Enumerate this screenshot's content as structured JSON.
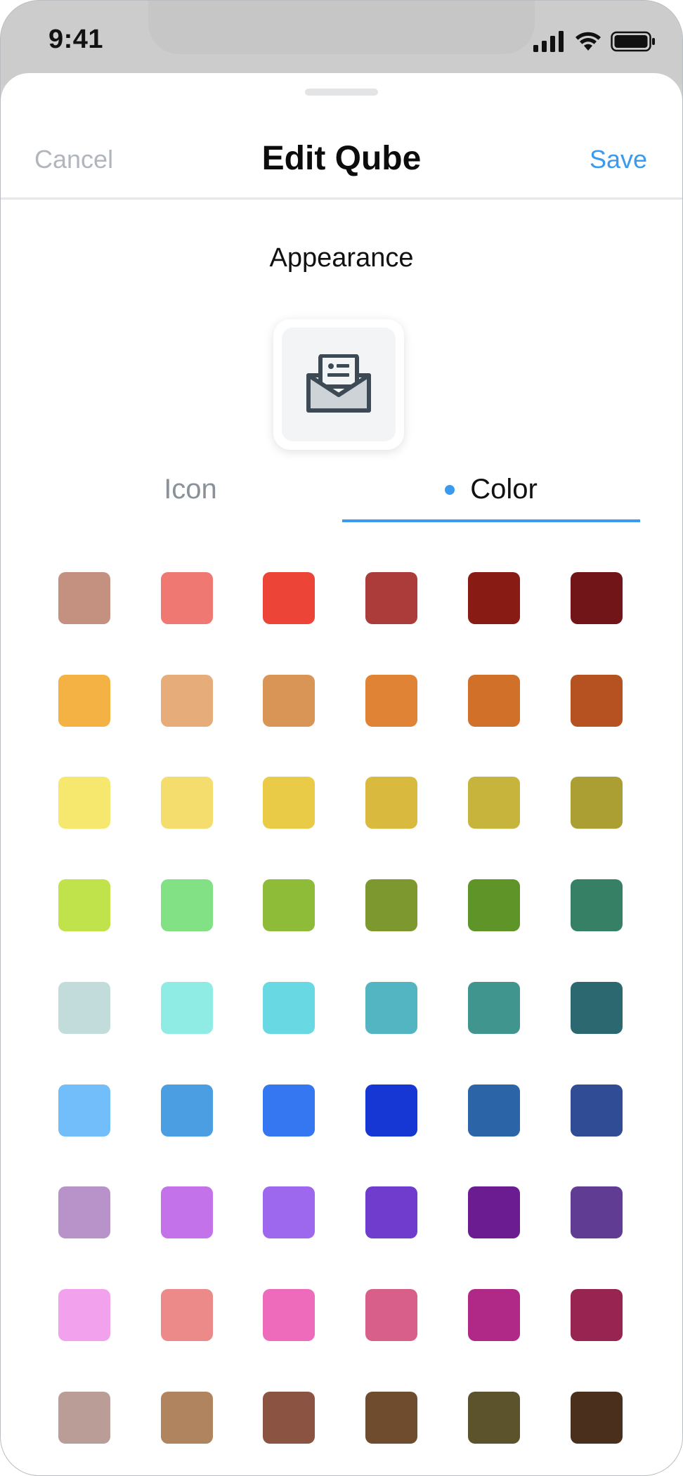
{
  "status_bar": {
    "time": "9:41",
    "icons": [
      "signal-icon",
      "wifi-icon",
      "battery-icon"
    ]
  },
  "nav": {
    "cancel_label": "Cancel",
    "title": "Edit Qube",
    "save_label": "Save",
    "accent_color": "#3a9af0"
  },
  "appearance": {
    "section_title": "Appearance",
    "preview_icon": "envelope-open-icon",
    "tabs": [
      {
        "label": "Icon",
        "selected": false
      },
      {
        "label": "Color",
        "selected": true
      }
    ]
  },
  "color_grid": {
    "rows": [
      [
        "#c49080",
        "#ef7873",
        "#ec4538",
        "#ab3c39",
        "#891b15",
        "#711519"
      ],
      [
        "#f4b244",
        "#e6ac79",
        "#d99555",
        "#e18335",
        "#d07029",
        "#b65121"
      ],
      [
        "#f6e76f",
        "#f4dd6d",
        "#eacb47",
        "#d9b93e",
        "#c6b43c",
        "#ab9f33"
      ],
      [
        "#c0e24a",
        "#82e184",
        "#8fbc38",
        "#7c982f",
        "#5f9428",
        "#368165"
      ],
      [
        "#c2dcdb",
        "#8fece4",
        "#68d8e2",
        "#53b4c2",
        "#40968e",
        "#2b6870"
      ],
      [
        "#72befa",
        "#4c9ee2",
        "#3576f1",
        "#1637d3",
        "#2c65a7",
        "#304c94"
      ],
      [
        "#b793ca",
        "#c472ea",
        "#9d68ee",
        "#703ccd",
        "#6b1c91",
        "#613c93"
      ],
      [
        "#f2a2ed",
        "#ec8a8a",
        "#ee6bbb",
        "#d75f89",
        "#b02986",
        "#972451"
      ],
      [
        "#bb9d97",
        "#b0845e",
        "#8b5442",
        "#704c2e",
        "#5c532c",
        "#4a301c"
      ]
    ]
  }
}
